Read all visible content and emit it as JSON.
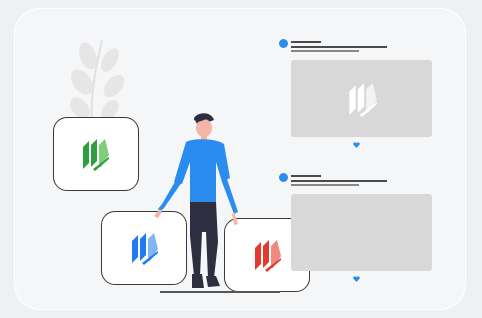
{
  "colors": {
    "background": "#eef0f3",
    "accent_blue": "#2b8cf0",
    "brand_green": "#2e9e3e",
    "brand_blue": "#1f7bef",
    "brand_red": "#e23b2c",
    "post_placeholder": "#d8d8d8",
    "person_shirt": "#2b8cf0",
    "person_pants": "#2f2e41",
    "person_skin": "#f3b6a6",
    "plant_leaf": "#e8e8e8"
  },
  "illustration": {
    "app_cards": [
      {
        "icon": "stacked-pages-logo-green-icon",
        "color": "#2e9e3e"
      },
      {
        "icon": "stacked-pages-logo-blue-icon",
        "color": "#1f7bef"
      },
      {
        "icon": "stacked-pages-logo-red-icon",
        "color": "#e23b2c"
      }
    ],
    "posts": [
      {
        "has_logo": true,
        "icon": "stacked-pages-logo-white-icon",
        "reaction_icon": "heart-icon"
      },
      {
        "has_logo": false,
        "reaction_icon": "heart-icon"
      }
    ]
  }
}
